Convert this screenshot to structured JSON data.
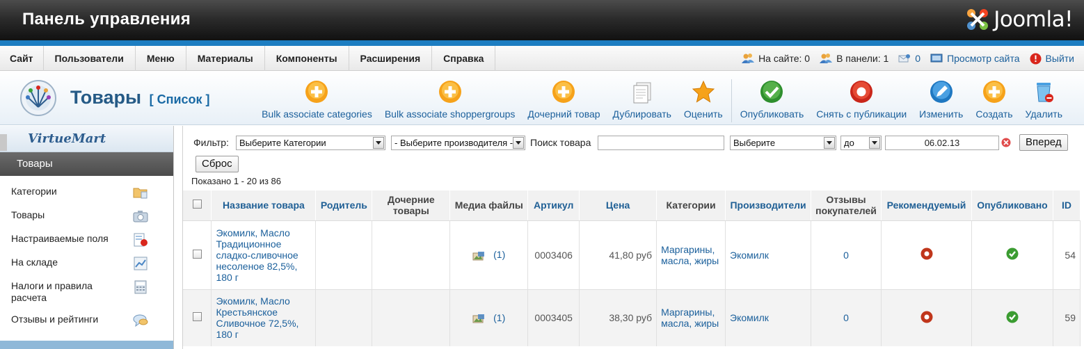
{
  "header": {
    "title": "Панель управления",
    "logo_text": "Joomla!"
  },
  "menubar": {
    "items": [
      "Сайт",
      "Пользователи",
      "Меню",
      "Материалы",
      "Компоненты",
      "Расширения",
      "Справка"
    ],
    "on_site": "На сайте: 0",
    "in_panel": "В панели: 1",
    "messages": "0",
    "view_site": "Просмотр сайта",
    "logout": "Выйти"
  },
  "toolbar": {
    "title": "Товары",
    "subtitle": "[ Список ]",
    "buttons": [
      {
        "label": "Bulk associate categories",
        "icon": "plus-icon"
      },
      {
        "label": "Bulk associate shoppergroups",
        "icon": "plus-icon"
      },
      {
        "label": "Дочерний товар",
        "icon": "plus-icon"
      },
      {
        "label": "Дублировать",
        "icon": "copy-icon"
      },
      {
        "label": "Оценить",
        "icon": "star-icon"
      },
      {
        "label": "Опубликовать",
        "icon": "check-icon"
      },
      {
        "label": "Снять с публикации",
        "icon": "unpublish-icon"
      },
      {
        "label": "Изменить",
        "icon": "pencil-icon"
      },
      {
        "label": "Создать",
        "icon": "plus-icon"
      },
      {
        "label": "Удалить",
        "icon": "trash-icon"
      }
    ]
  },
  "sidebar": {
    "logo_text": "VirtueMart",
    "section": "Товары",
    "items": [
      {
        "label": "Категории",
        "icon": "folder-icon"
      },
      {
        "label": "Товары",
        "icon": "camera-icon"
      },
      {
        "label": "Настраиваемые поля",
        "icon": "fields-icon"
      },
      {
        "label": "На складе",
        "icon": "chart-icon"
      },
      {
        "label": "Налоги и правила расчета",
        "icon": "calculator-icon"
      },
      {
        "label": "Отзывы и рейтинги",
        "icon": "comment-icon"
      }
    ]
  },
  "filters": {
    "label": "Фильтр:",
    "category": "Выберите Категории",
    "manufacturer": "- Выберите производителя -",
    "search_label": "Поиск товара",
    "search_value": "",
    "date_select": "Выберите",
    "until": "до",
    "date": "06.02.13",
    "go": "Вперед",
    "reset": "Сброс",
    "count": "Показано 1 - 20 из 86"
  },
  "table": {
    "headers": [
      "Название товара",
      "Родитель",
      "Дочерние товары",
      "Медиа файлы",
      "Артикул",
      "Цена",
      "Категории",
      "Производители",
      "Отзывы покупателей",
      "Рекомендуемый",
      "Опубликовано",
      "ID"
    ],
    "rows": [
      {
        "name": "Экомилк, Масло Традиционное сладко-сливочное несоленое 82,5%, 180 г",
        "media": "(1)",
        "sku": "0003406",
        "price": "41,80 руб",
        "category": "Маргарины, масла, жиры",
        "manufacturer": "Экомилк",
        "reviews": "0",
        "id": "54"
      },
      {
        "name": "Экомилк, Масло Крестьянское Сливочное 72,5%, 180 г",
        "media": "(1)",
        "sku": "0003405",
        "price": "38,30 руб",
        "category": "Маргарины, масла, жиры",
        "manufacturer": "Экомилк",
        "reviews": "0",
        "id": "59"
      }
    ]
  },
  "colors": {
    "accent": "#1c7dc1",
    "link": "#1a5f9b",
    "publish": "#2f9e2f",
    "featured": "#cc3a1a"
  }
}
